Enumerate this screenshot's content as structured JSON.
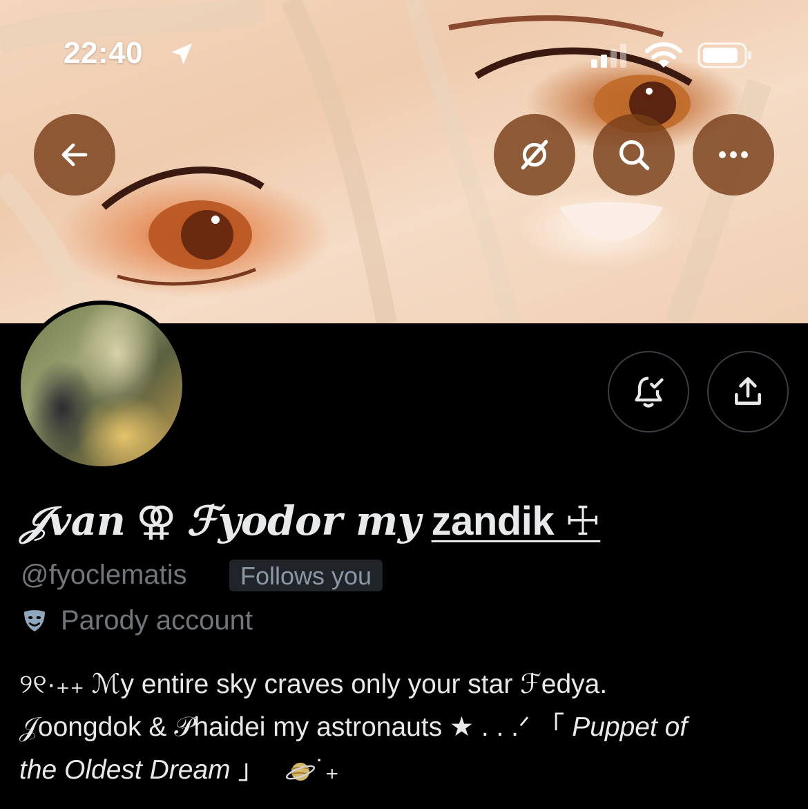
{
  "status_bar": {
    "time": "22:40",
    "location_icon": "location-arrow-icon",
    "signal_icon": "cellular-signal-icon",
    "wifi_icon": "wifi-icon",
    "battery_icon": "battery-icon"
  },
  "banner": {
    "back_icon": "arrow-left-icon",
    "grok_icon": "grok-icon",
    "search_icon": "search-icon",
    "more_icon": "more-horizontal-icon"
  },
  "profile_actions": {
    "bell_icon": "bell-check-icon",
    "share_icon": "share-icon"
  },
  "profile": {
    "name_part1": "𝒥van",
    "name_symbol": "⚢",
    "name_part2": "ℱyodor my",
    "name_link": "zandik ☩",
    "handle": "@fyoclematis",
    "follows_you": "Follows you",
    "parody_label": "Parody account",
    "parody_icon": "theater-mask-icon"
  },
  "bio": {
    "line1": "୨୧·₊₊ ℳy entire sky craves only your star ℱedya.",
    "line2_normal": "𝒥oongdok & 𝒫haidei my astronauts ★ . . .ᐟ  「",
    "line2_italic": "Puppet of",
    "line3_italic": "the Oldest Dream",
    "line3_close": "」",
    "line3_tail": "˙₊",
    "planet_icon": "ringed-planet-icon"
  },
  "colors": {
    "background": "#000000",
    "text_primary": "#e7e9ea",
    "text_secondary": "#71767b",
    "banner_button": "#783e1a",
    "outline": "#3a3f44"
  }
}
